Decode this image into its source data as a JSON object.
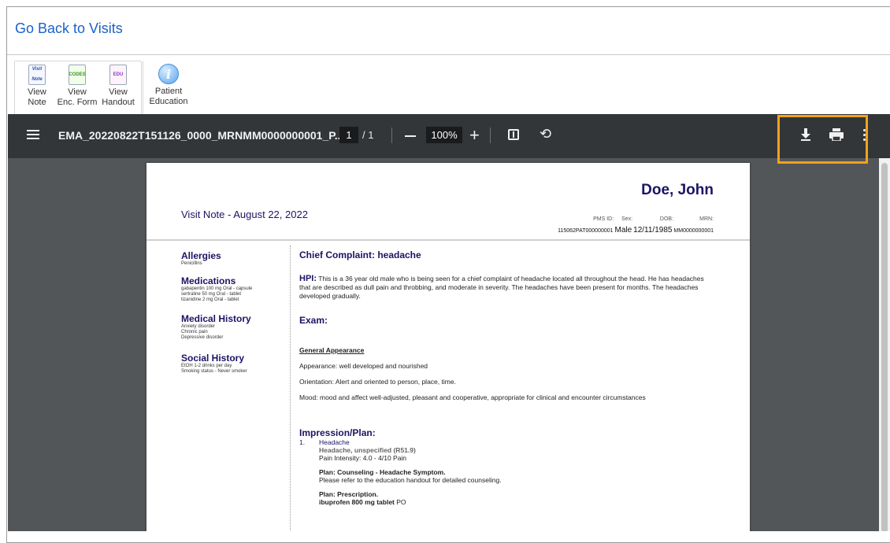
{
  "header": {
    "go_back_label": "Go Back to Visits"
  },
  "toolbar": {
    "buttons": [
      {
        "label_line1": "View",
        "label_line2": "Note",
        "icon_text": "Visit Note",
        "icon": "visit-note-icon"
      },
      {
        "label_line1": "View",
        "label_line2": "Enc. Form",
        "icon_text": "CODES",
        "icon": "codes-icon"
      },
      {
        "label_line1": "View",
        "label_line2": "Handout",
        "icon_text": "EDU",
        "icon": "handout-icon"
      },
      {
        "label_line1": "Patient",
        "label_line2": "Education",
        "icon_text": "i",
        "icon": "info-icon"
      }
    ]
  },
  "viewer": {
    "filename": "EMA_20220822T151126_0000_MRNMM0000000001_P...",
    "page_current": "1",
    "page_total": "/ 1",
    "zoom": "100%",
    "highlight_color": "#f5a21b",
    "icons": [
      "menu-icon",
      "zoom-out-icon",
      "zoom-in-icon",
      "fit-page-icon",
      "rotate-icon",
      "download-icon",
      "print-icon",
      "more-icon"
    ]
  },
  "document": {
    "patient_name": "Doe, John",
    "visit_title": "Visit Note - August 22, 2022",
    "demographics": {
      "labels": [
        "PMS ID:",
        "Sex:",
        "DOB:",
        "MRN:"
      ],
      "pms_id": "115062PAT000000001",
      "sex": "Male",
      "dob": "12/11/1985",
      "mrn": "MM0000000001"
    },
    "sidebar": [
      {
        "title": "Allergies",
        "items": [
          "Penicillins"
        ]
      },
      {
        "title": "Medications",
        "items": [
          "gabapentin 100 mg Oral - capsule",
          "sertraline 50 mg Oral - tablet",
          "tizanidine 2 mg Oral - tablet"
        ]
      },
      {
        "title": "Medical History",
        "items": [
          "Anxiety disorder",
          "Chronic pain",
          "Depressive disorder"
        ]
      },
      {
        "title": "Social History",
        "items": [
          "EtOH 1-2 drinks per day",
          "Smoking status - Never smoker"
        ]
      }
    ],
    "chief_complaint": "Chief Complaint: headache",
    "hpi_label": "HPI:",
    "hpi_text": "This is a 36 year old male who is being seen for a chief complaint of headache located all throughout the head. He has headaches that are described as dull pain and throbbing, and moderate in severity. The headaches have been present for  months. The headaches developed gradually.",
    "exam_title": "Exam:",
    "general_appearance_title": "General Appearance",
    "exam_lines": [
      "Appearance: well developed and nourished",
      "Orientation: Alert and oriented to person, place, time.",
      "Mood: mood and affect well-adjusted, pleasant and cooperative, appropriate for clinical and encounter circumstances"
    ],
    "impression_title": "Impression/Plan:",
    "plan": {
      "number": "1.",
      "diagnosis": "Headache",
      "code": "Headache, unspecified (R51.9)",
      "pain": "Pain Intensity: 4.0 - 4/10 Pain",
      "counseling_title": "Plan: Counseling - Headache Symptom.",
      "counseling_text": "Please refer to the education handout for detailed counseling.",
      "prescription_title": "Plan: Prescription.",
      "prescription_drug": "ibuprofen 800 mg tablet",
      "prescription_route": " PO"
    }
  }
}
